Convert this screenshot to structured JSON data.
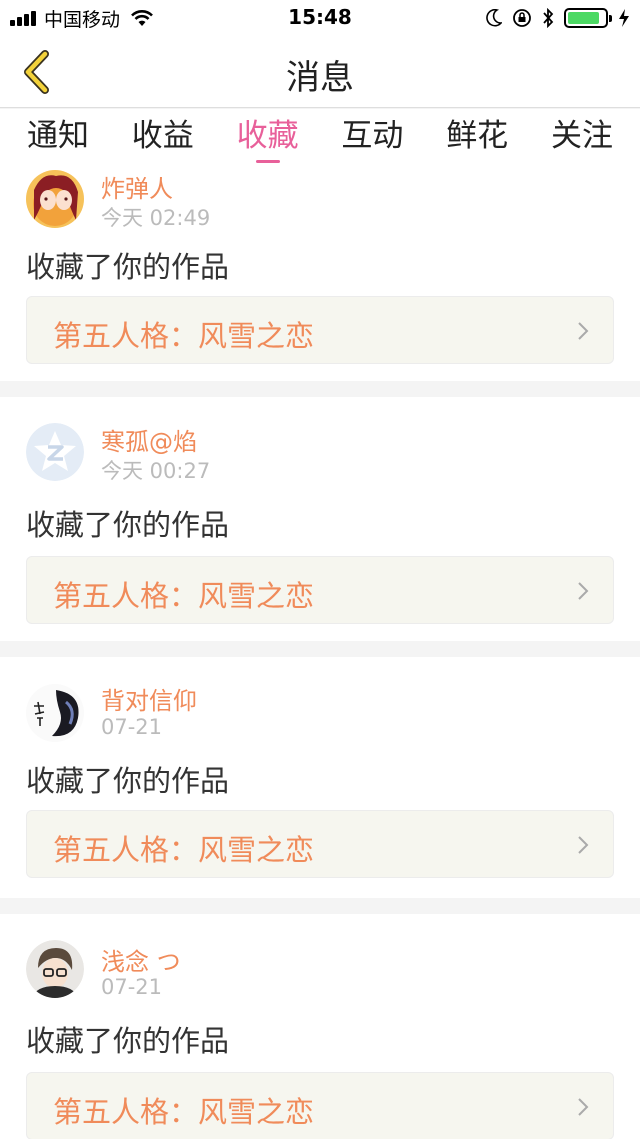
{
  "status_bar": {
    "carrier": "中国移动",
    "time": "15:48",
    "battery_level": 0.85,
    "icons": [
      "signal-icon",
      "wifi-icon",
      "moon-icon",
      "orientation-lock-icon",
      "bluetooth-icon",
      "battery-icon",
      "charging-icon"
    ]
  },
  "nav": {
    "title": "消息",
    "back_icon": "chevron-left-icon"
  },
  "tabs": [
    {
      "label": "通知",
      "active": false
    },
    {
      "label": "收益",
      "active": false
    },
    {
      "label": "收藏",
      "active": true
    },
    {
      "label": "互动",
      "active": false
    },
    {
      "label": "鲜花",
      "active": false
    },
    {
      "label": "关注",
      "active": false
    }
  ],
  "items": [
    {
      "user": "炸弹人",
      "time": "今天 02:49",
      "action": "收藏了你的作品",
      "work": "第五人格：风雪之恋"
    },
    {
      "user": "寒孤@焰",
      "time": "今天 00:27",
      "action": "收藏了你的作品",
      "work": "第五人格：风雪之恋"
    },
    {
      "user": "背对信仰",
      "time": "07-21",
      "action": "收藏了你的作品",
      "work": "第五人格：风雪之恋"
    },
    {
      "user": "浅念 つ",
      "time": "07-21",
      "action": "收藏了你的作品",
      "work": "第五人格：风雪之恋"
    }
  ],
  "colors": {
    "accent": "#e8609a",
    "username": "#f08b5a",
    "work_bg": "#f6f6ef",
    "battery": "#4cd964",
    "back_arrow": "#f3d23a"
  }
}
